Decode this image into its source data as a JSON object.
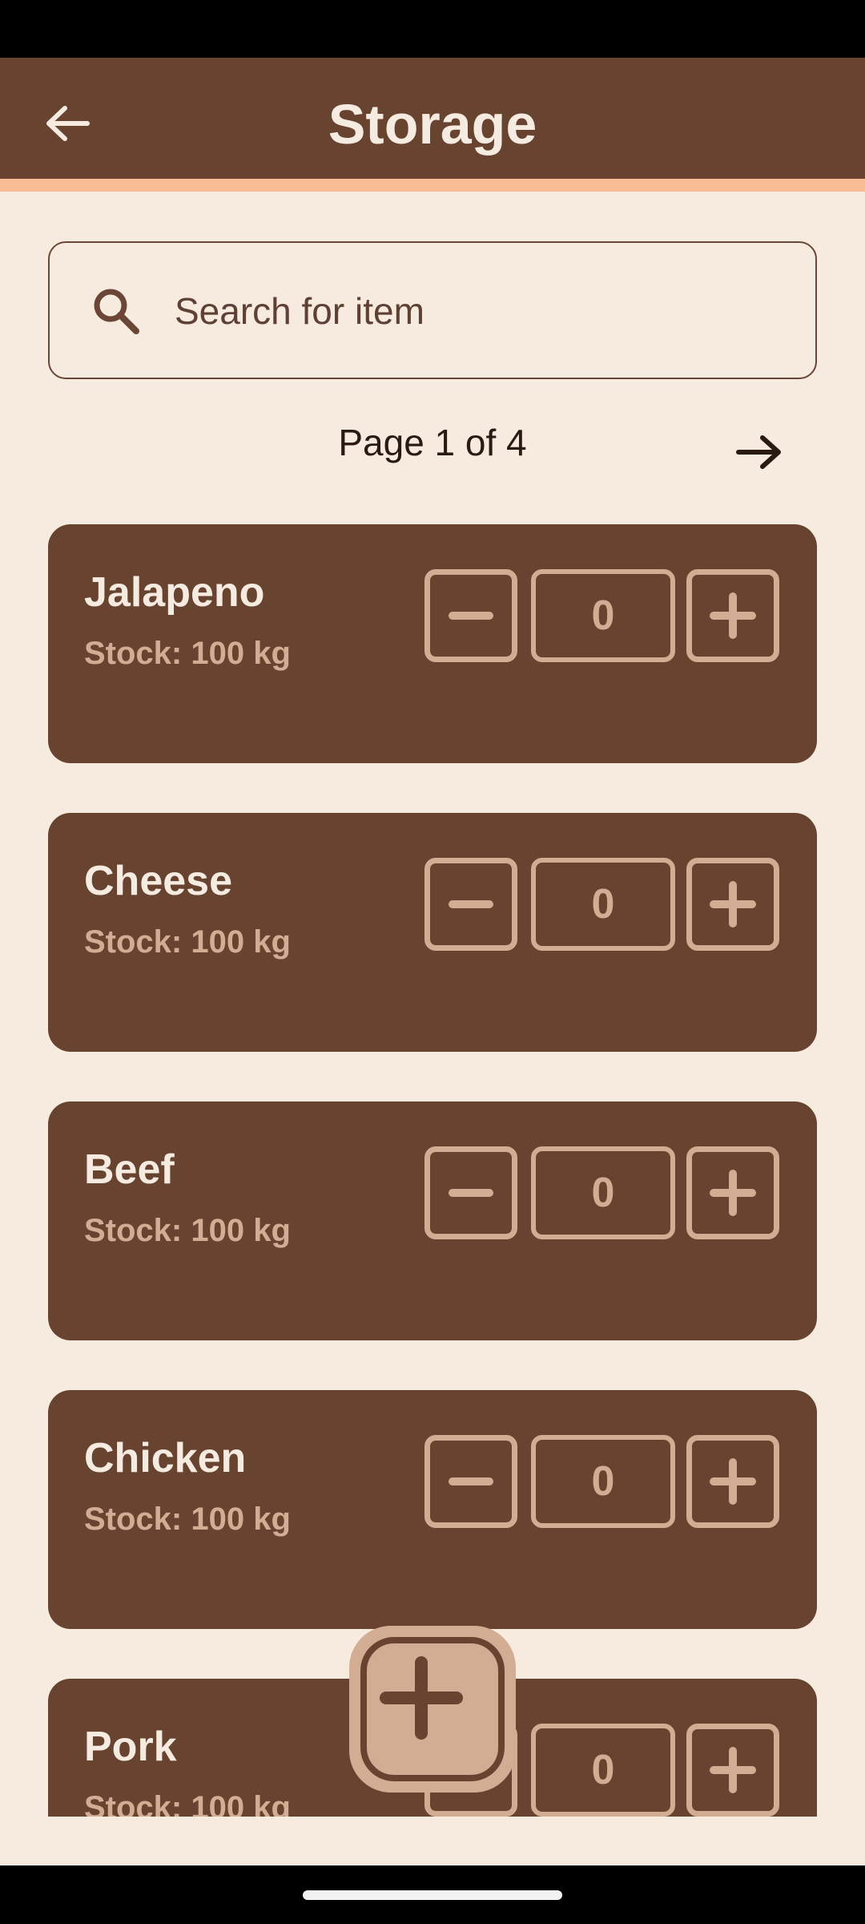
{
  "app_bar": {
    "title": "Storage",
    "back_icon": "arrow-left-icon",
    "background_color": "#684430",
    "accent_color": "#F8BD95"
  },
  "search": {
    "placeholder": "Search for item",
    "value": "",
    "icon": "search-icon"
  },
  "pagination": {
    "label": "Page 1 of 4",
    "next_icon": "arrow-right-icon"
  },
  "items": [
    {
      "name": "Jalapeno",
      "stock": "Stock: 100 kg",
      "quantity": "0"
    },
    {
      "name": "Cheese",
      "stock": "Stock: 100 kg",
      "quantity": "0"
    },
    {
      "name": "Beef",
      "stock": "Stock: 100 kg",
      "quantity": "0"
    },
    {
      "name": "Chicken",
      "stock": "Stock: 100 kg",
      "quantity": "0"
    },
    {
      "name": "Pork",
      "stock": "Stock: 100 kg",
      "quantity": "0"
    }
  ],
  "fab": {
    "icon": "plus-icon"
  },
  "colors": {
    "background": "#F7EBE0",
    "card": "#684430",
    "card_accent": "#D3AD93",
    "card_title": "#F6EBE1"
  }
}
